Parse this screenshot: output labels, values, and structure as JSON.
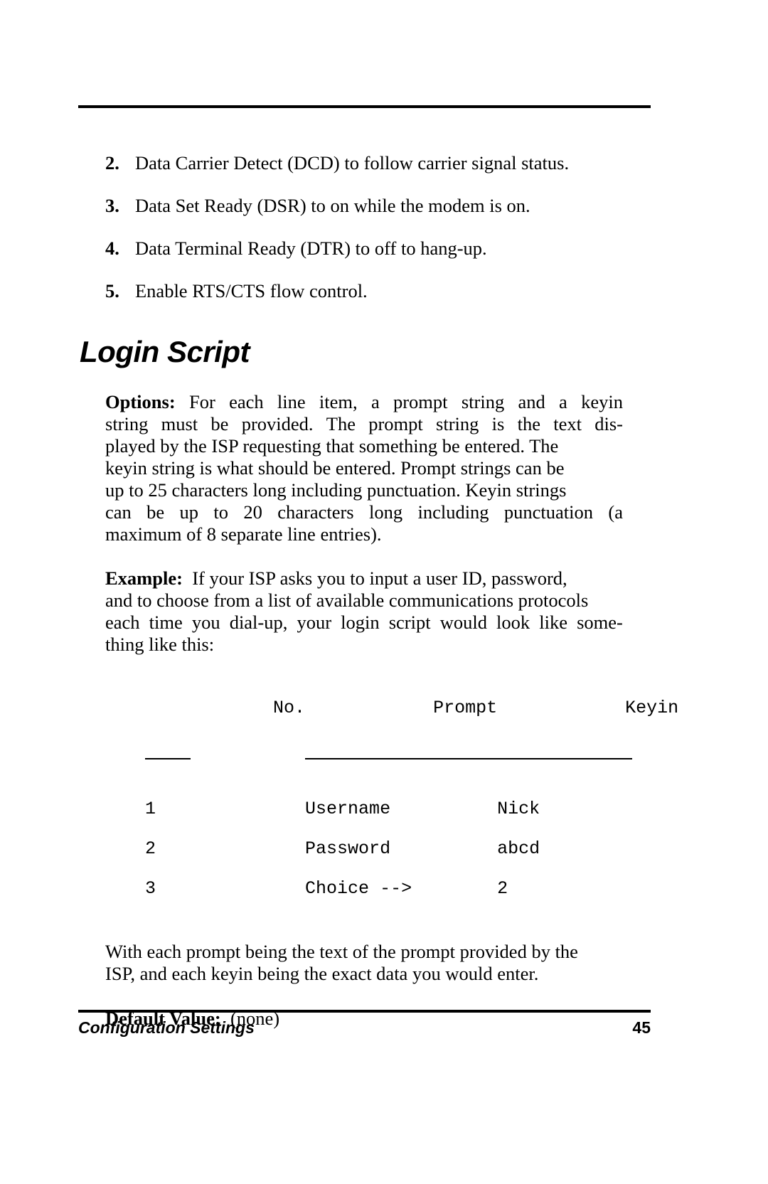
{
  "document": {
    "page_number": "45",
    "footer_title": "Configuration Settings"
  },
  "list": {
    "items": [
      {
        "marker": "2.",
        "line1_words": [
          "Data",
          "Carrier",
          "Detect",
          "(DCD)",
          "to",
          "follow",
          "carrier",
          "signal"
        ],
        "line2": "status.",
        "text": "Data Carrier Detect (DCD) to follow carrier signal status."
      },
      {
        "marker": "3.",
        "text": "Data Set Ready (DSR) to on while the modem is on."
      },
      {
        "marker": "4.",
        "text": "Data Terminal Ready (DTR) to off  to hang-up."
      },
      {
        "marker": "5.",
        "text": "Enable RTS/CTS flow control."
      }
    ]
  },
  "heading": {
    "title": "Login Script"
  },
  "options": {
    "label": "Options:",
    "line1": [
      "For",
      "each",
      "line",
      "item,",
      "a",
      "prompt",
      "string",
      "and",
      "a",
      "keyin"
    ],
    "line2": [
      "string",
      "must",
      "be",
      "provided.",
      "The",
      "prompt",
      "string",
      "is",
      "the",
      "text",
      "dis-"
    ],
    "line3": "played by the ISP requesting that something be entered.  The",
    "line4": "keyin string is what should be entered.  Prompt strings can be",
    "line5": "up to 25 characters long including punctuation.  Keyin strings",
    "line6": [
      "can",
      "be",
      "up",
      "to",
      "20",
      "characters",
      "long",
      "including",
      "punctuation",
      "(a"
    ],
    "line7": "maximum of 8 separate line entries).",
    "text": "Options:  For each line item, a prompt string and a keyin string must be provided.  The prompt string is the text displayed by the ISP requesting that something be entered.  The keyin string is what should be entered.  Prompt strings can be up to 25 characters long including punctuation.  Keyin strings can be up to 20 characters long including punctuation (a maximum of 8 separate line entries)."
  },
  "example": {
    "label": "Example:",
    "line1": "If your ISP asks you to input a user ID, password,",
    "line2": "and to choose from a list of available communications protocols",
    "line3": [
      "each",
      "time",
      "you",
      "dial-up,",
      "your",
      "login",
      "script",
      "would",
      "look",
      "like",
      "some-"
    ],
    "line4": "thing like this:",
    "text": "Example:  If your ISP asks you to input a user ID, password, and to choose from a list of available communications protocols each time you dial-up, your login script would look like something like this:"
  },
  "table": {
    "headers": [
      "No.",
      "Prompt",
      "Keyin"
    ],
    "rows": [
      {
        "no": "1",
        "prompt": "Username",
        "keyin": "Nick"
      },
      {
        "no": "2",
        "prompt": "Password",
        "keyin": "abcd"
      },
      {
        "no": "3",
        "prompt": "Choice -->",
        "keyin": "2"
      }
    ]
  },
  "closing": {
    "line1": "With each prompt being the text of the prompt provided by the",
    "line2": "ISP, and each keyin being the exact data you would enter.",
    "text": "With each prompt being the text of the prompt provided by the ISP, and each keyin being the exact data you would enter."
  },
  "default_value": {
    "label": "Default Value:",
    "value": "(none)"
  }
}
